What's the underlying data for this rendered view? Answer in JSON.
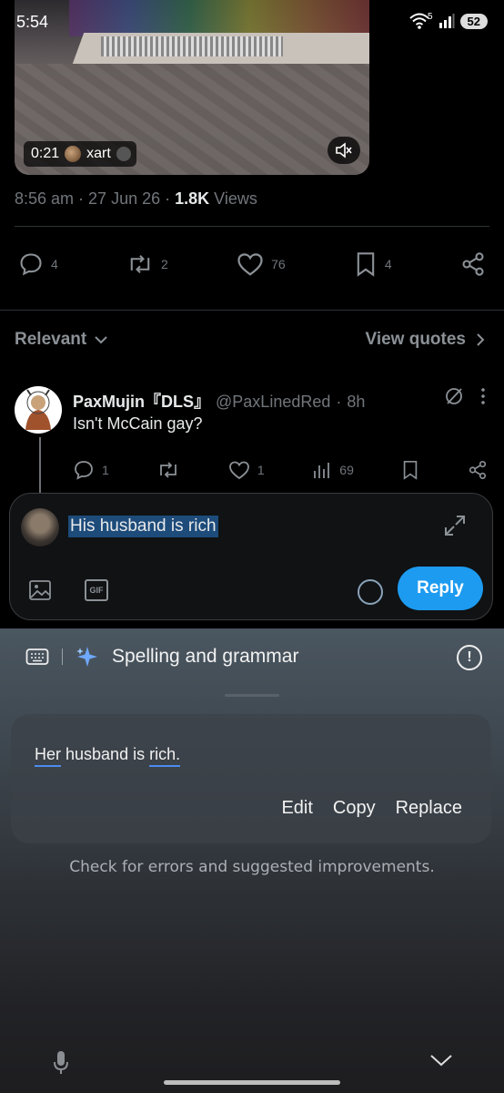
{
  "status": {
    "time": "5:54",
    "wifi_label": "5",
    "battery": "52"
  },
  "video": {
    "duration": "0:21",
    "username": "xart"
  },
  "tweet": {
    "time": "8:56 am",
    "date": "27 Jun 26",
    "views_count": "1.8K",
    "views_label": "Views",
    "replies": "4",
    "reposts": "2",
    "likes": "76",
    "bookmarks": "4"
  },
  "filters": {
    "sort_label": "Relevant",
    "view_quotes": "View quotes"
  },
  "reply_tweet": {
    "name": "PaxMujin『DLS』",
    "handle": "@PaxLinedRed",
    "time": "8h",
    "text": "Isn't McCain gay?",
    "replies": "1",
    "likes": "1",
    "views": "69"
  },
  "compose": {
    "text": "His husband is rich",
    "reply_label": "Reply",
    "gif_label": "GIF"
  },
  "keyboard": {
    "title": "Spelling and grammar",
    "suggestion_word1": "Her",
    "suggestion_middle": " husband is ",
    "suggestion_word2": "rich.",
    "edit_label": "Edit",
    "copy_label": "Copy",
    "replace_label": "Replace",
    "hint": "Check for errors and suggested improvements."
  },
  "colors": {
    "accent": "#1d9bf0",
    "highlight": "#1d4b7a",
    "underline": "#4b8cf0"
  }
}
